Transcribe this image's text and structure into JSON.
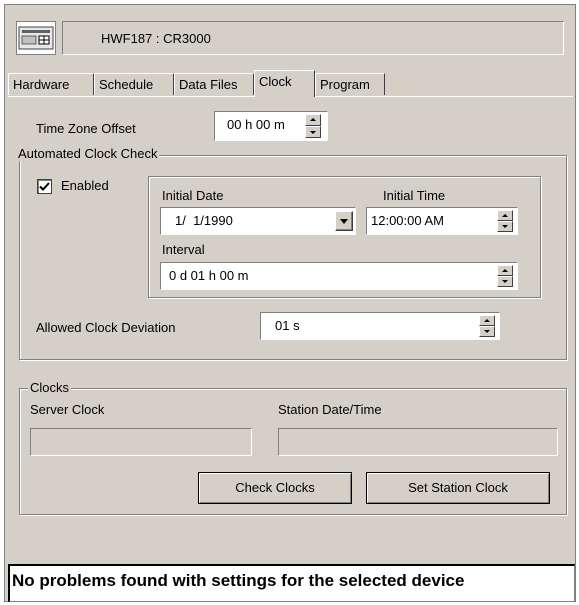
{
  "header": {
    "title": "HWF187 : CR3000",
    "icon": "datalogger-icon"
  },
  "tabs": [
    {
      "label": "Hardware"
    },
    {
      "label": "Schedule"
    },
    {
      "label": "Data Files"
    },
    {
      "label": "Clock",
      "active": true
    },
    {
      "label": "Program"
    }
  ],
  "timezone": {
    "label": "Time Zone Offset",
    "value": "00 h 00 m"
  },
  "auto_check": {
    "legend": "Automated Clock Check",
    "enabled_label": "Enabled",
    "enabled": true,
    "initial_date_label": "Initial Date",
    "initial_date_value": "1/  1/1990",
    "initial_time_label": "Initial Time",
    "initial_time_value": "12:00:00 AM",
    "interval_label": "Interval",
    "interval_value": "0 d 01 h 00 m",
    "deviation_label": "Allowed Clock Deviation",
    "deviation_value": "01 s"
  },
  "clocks": {
    "legend": "Clocks",
    "server_label": "Server Clock",
    "server_value": "",
    "station_label": "Station Date/Time",
    "station_value": "",
    "check_button": "Check Clocks",
    "set_button": "Set Station Clock"
  },
  "status": {
    "message": "No problems found with settings for the selected device"
  }
}
